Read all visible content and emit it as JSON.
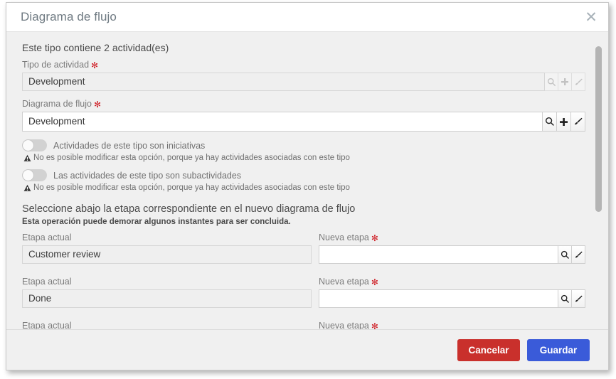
{
  "dialog": {
    "title": "Diagrama de flujo",
    "close_icon": "close-icon"
  },
  "body": {
    "activity_count_text": "Este tipo contiene 2 actividad(es)",
    "fields": [
      {
        "label": "Tipo de actividad",
        "required_marker": "✻",
        "value": "Development",
        "disabled": true,
        "buttons": [
          "search-icon",
          "plus-icon",
          "brush-icon"
        ]
      },
      {
        "label": "Diagrama de flujo",
        "required_marker": "✻",
        "value": "Development",
        "disabled": false,
        "buttons": [
          "search-icon",
          "plus-icon",
          "brush-icon"
        ]
      }
    ],
    "toggles": [
      {
        "label": "Actividades de este tipo son iniciativas",
        "state": "off",
        "warning": "No es posible modificar esta opción, porque ya hay actividades asociadas con este tipo"
      },
      {
        "label": "Las actividades de este tipo son subactividades",
        "state": "off",
        "warning": "No es posible modificar esta opción, porque ya hay actividades asociadas con este tipo"
      }
    ],
    "stages": {
      "heading": "Seleccione abajo la etapa correspondiente en el nuevo diagrama de flujo",
      "subheading": "Esta operación puede demorar algunos instantes para ser concluida.",
      "current_label": "Etapa actual",
      "new_label": "Nueva etapa",
      "required_marker": "✻",
      "rows": [
        {
          "current": "Customer review",
          "new_value": "",
          "new_placeholder": ""
        },
        {
          "current": "Done",
          "new_value": "",
          "new_placeholder": ""
        },
        {
          "current": "",
          "new_value": "",
          "new_placeholder": ""
        }
      ]
    }
  },
  "footer": {
    "cancel_label": "Cancelar",
    "save_label": "Guardar"
  },
  "colors": {
    "cancel": "#c9302c",
    "save": "#3a5bd9",
    "required": "#cf2027",
    "body_bg": "#f0f0f0"
  }
}
